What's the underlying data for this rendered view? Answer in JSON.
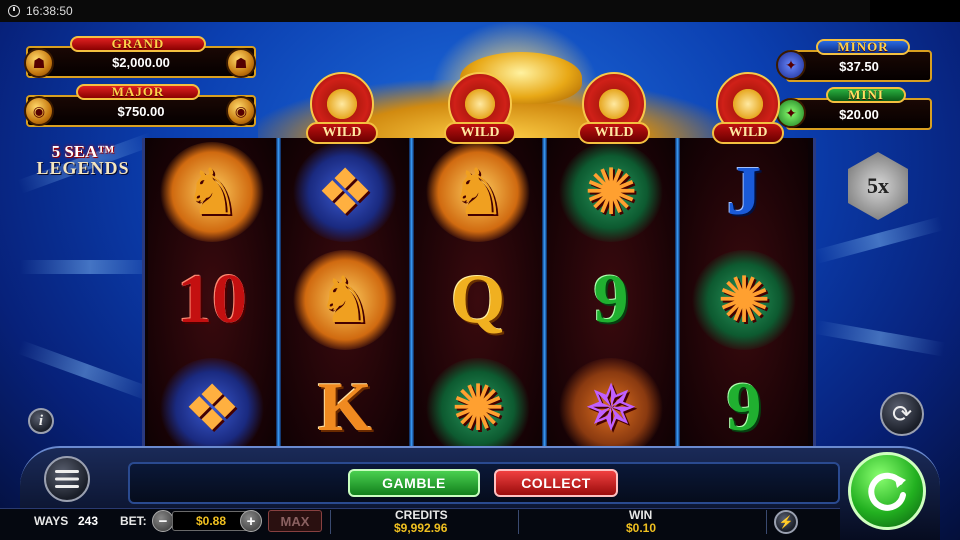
{
  "status_bar": {
    "time": "16:38:50"
  },
  "jackpots": {
    "grand": {
      "title": "GRAND",
      "value": "$2,000.00"
    },
    "major": {
      "title": "MAJOR",
      "value": "$750.00"
    },
    "minor": {
      "title": "MINOR",
      "value": "$37.50"
    },
    "mini": {
      "title": "MINI",
      "value": "$20.00"
    }
  },
  "logo": {
    "line1": "5 SEA™",
    "line2": "LEGENDS"
  },
  "wild_label": "WILD",
  "multiplier": "5x",
  "reels": [
    [
      {
        "symbol": "seahorse",
        "icon": "seahorse-icon"
      },
      {
        "symbol": "10",
        "color": "red"
      },
      {
        "symbol": "twin-fish",
        "icon": "twin-fish-icon"
      }
    ],
    [
      {
        "symbol": "twin-fish",
        "icon": "twin-fish-icon"
      },
      {
        "symbol": "seahorse",
        "icon": "seahorse-icon"
      },
      {
        "symbol": "K",
        "color": "orange"
      }
    ],
    [
      {
        "symbol": "seahorse",
        "icon": "seahorse-icon"
      },
      {
        "symbol": "Q",
        "color": "gold"
      },
      {
        "symbol": "turtle",
        "icon": "turtle-icon"
      }
    ],
    [
      {
        "symbol": "turtle",
        "icon": "turtle-icon"
      },
      {
        "symbol": "9",
        "color": "green"
      },
      {
        "symbol": "crab",
        "icon": "crab-icon"
      }
    ],
    [
      {
        "symbol": "J",
        "color": "blue"
      },
      {
        "symbol": "turtle",
        "icon": "turtle-icon"
      },
      {
        "symbol": "9",
        "color": "green"
      }
    ]
  ],
  "buttons": {
    "gamble": "GAMBLE",
    "collect": "COLLECT",
    "max": "MAX",
    "minus": "−",
    "plus": "+"
  },
  "info_bar": {
    "ways_label": "WAYS",
    "ways_value": "243",
    "bet_label": "BET:",
    "bet_value": "$0.88",
    "credits_label": "CREDITS",
    "credits_value": "$9,992.96",
    "win_label": "WIN",
    "win_value": "$0.10"
  },
  "icons": [
    "clock-icon",
    "info-icon",
    "menu-icon",
    "autoplay-icon",
    "spin-icon",
    "turbo-icon"
  ],
  "colors": {
    "gamble": "#22a030",
    "collect": "#d02020",
    "value_text": "#f0c020",
    "background_blue": "#0b3fb0"
  }
}
